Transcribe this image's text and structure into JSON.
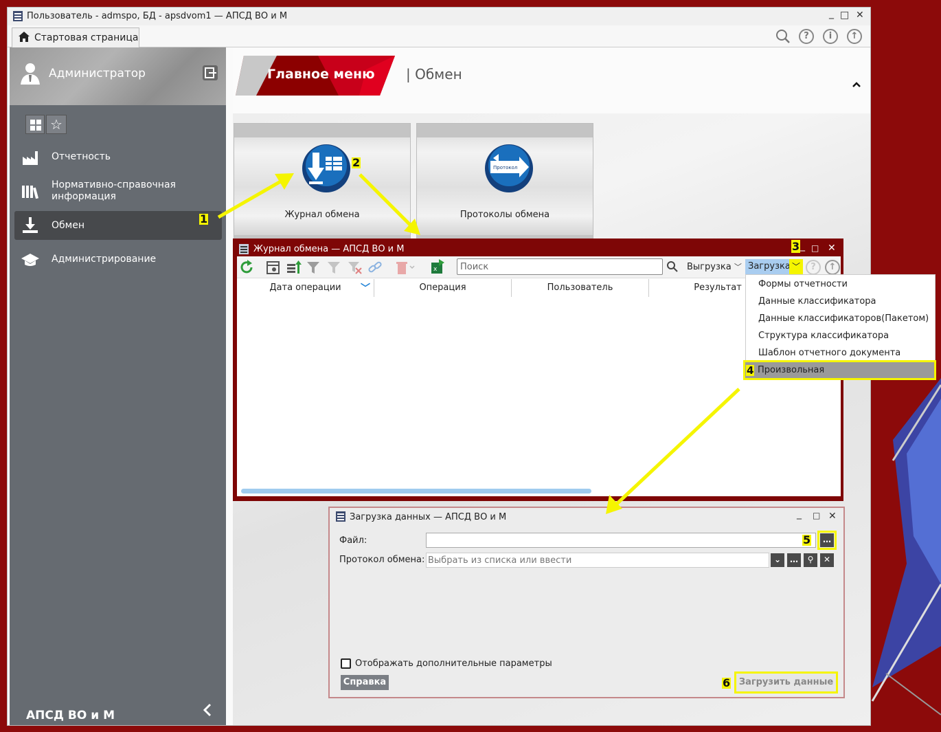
{
  "window": {
    "title": "Пользователь - admspo, БД - apsdvom1 — АПСД ВО и М",
    "start_tab": "Стартовая страница"
  },
  "sidebar": {
    "user": "Администратор",
    "items": [
      {
        "label": "Отчетность"
      },
      {
        "label": "Нормативно-справочная информация"
      },
      {
        "label": "Обмен"
      },
      {
        "label": "Администрирование"
      }
    ],
    "footer": "АПСД ВО и М"
  },
  "header": {
    "menu_title": "Главное меню",
    "crumb": "| Обмен"
  },
  "tiles": [
    {
      "label": "Журнал обмена"
    },
    {
      "label": "Протоколы обмена",
      "icon_caption": "Протокол"
    }
  ],
  "journal": {
    "title": "Журнал обмена — АПСД ВО и М",
    "search_placeholder": "Поиск",
    "export_label": "Выгрузка",
    "import_label": "Загрузка",
    "columns": [
      "Дата операции",
      "Операция",
      "Пользователь",
      "Результат"
    ]
  },
  "import_menu": {
    "items": [
      "Формы отчетности",
      "Данные классификатора",
      "Данные классификаторов(Пакетом)",
      "Структура классификатора",
      "Шаблон отчетного документа",
      "Произвольная"
    ],
    "selected_index": 5
  },
  "load_dialog": {
    "title": "Загрузка данных — АПСД ВО и М",
    "file_label": "Файл:",
    "file_value": "",
    "protocol_label": "Протокол обмена:",
    "protocol_placeholder": "Выбрать из списка или ввести",
    "checkbox_label": "Отображать дополнительные параметры",
    "help_button": "Справка",
    "load_button": "Загрузить данные"
  },
  "annotations": [
    "1",
    "2",
    "3",
    "4",
    "5",
    "6"
  ],
  "colors": {
    "desktop": "#8c0a0a",
    "sidebar": "#666b71",
    "sidebar_active": "#47494c",
    "highlight": "#f5f500",
    "accent_blue": "#1a6fbd"
  },
  "icons": [
    "home-icon",
    "search-icon",
    "help-icon",
    "info-icon",
    "upload-icon",
    "user-icon",
    "logout-icon",
    "grid-icon",
    "star-icon",
    "factory-icon",
    "books-icon",
    "import-icon",
    "graduation-cap-icon",
    "collapse-left-icon",
    "chevron-up-icon",
    "refresh-icon",
    "filter-icon",
    "link-icon",
    "delete-icon",
    "excel-icon"
  ]
}
